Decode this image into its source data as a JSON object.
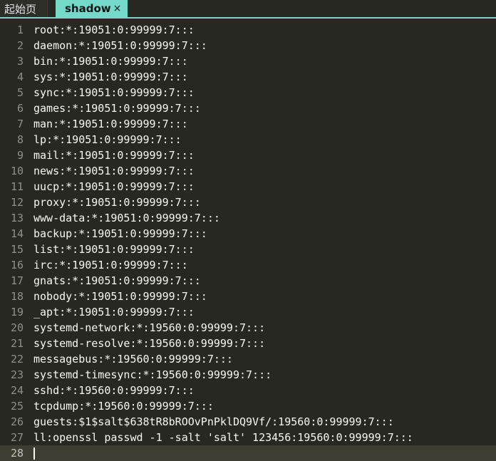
{
  "tabs": [
    {
      "label": "起始页",
      "active": false
    },
    {
      "label": "shadow",
      "active": true,
      "close_glyph": "×"
    }
  ],
  "editor": {
    "lines": [
      {
        "num": "1",
        "text": "root:*:19051:0:99999:7:::"
      },
      {
        "num": "2",
        "text": "daemon:*:19051:0:99999:7:::"
      },
      {
        "num": "3",
        "text": "bin:*:19051:0:99999:7:::"
      },
      {
        "num": "4",
        "text": "sys:*:19051:0:99999:7:::"
      },
      {
        "num": "5",
        "text": "sync:*:19051:0:99999:7:::"
      },
      {
        "num": "6",
        "text": "games:*:19051:0:99999:7:::"
      },
      {
        "num": "7",
        "text": "man:*:19051:0:99999:7:::"
      },
      {
        "num": "8",
        "text": "lp:*:19051:0:99999:7:::"
      },
      {
        "num": "9",
        "text": "mail:*:19051:0:99999:7:::"
      },
      {
        "num": "10",
        "text": "news:*:19051:0:99999:7:::"
      },
      {
        "num": "11",
        "text": "uucp:*:19051:0:99999:7:::"
      },
      {
        "num": "12",
        "text": "proxy:*:19051:0:99999:7:::"
      },
      {
        "num": "13",
        "text": "www-data:*:19051:0:99999:7:::"
      },
      {
        "num": "14",
        "text": "backup:*:19051:0:99999:7:::"
      },
      {
        "num": "15",
        "text": "list:*:19051:0:99999:7:::"
      },
      {
        "num": "16",
        "text": "irc:*:19051:0:99999:7:::"
      },
      {
        "num": "17",
        "text": "gnats:*:19051:0:99999:7:::"
      },
      {
        "num": "18",
        "text": "nobody:*:19051:0:99999:7:::"
      },
      {
        "num": "19",
        "text": "_apt:*:19051:0:99999:7:::"
      },
      {
        "num": "20",
        "text": "systemd-network:*:19560:0:99999:7:::"
      },
      {
        "num": "21",
        "text": "systemd-resolve:*:19560:0:99999:7:::"
      },
      {
        "num": "22",
        "text": "messagebus:*:19560:0:99999:7:::"
      },
      {
        "num": "23",
        "text": "systemd-timesync:*:19560:0:99999:7:::"
      },
      {
        "num": "24",
        "text": "sshd:*:19560:0:99999:7:::"
      },
      {
        "num": "25",
        "text": "tcpdump:*:19560:0:99999:7:::"
      },
      {
        "num": "26",
        "text": "guests:$1$salt$638tR8bROOvPnPklDQ9Vf/:19560:0:99999:7:::"
      },
      {
        "num": "27",
        "text": "ll:openssl passwd -1 -salt 'salt' 123456:19560:0:99999:7:::"
      },
      {
        "num": "28",
        "text": ""
      }
    ],
    "current_line": 28
  },
  "colors": {
    "background": "#272822",
    "tab_active": "#74d9c8",
    "text": "#f8f8f2",
    "line_number": "#8f908a",
    "current_line_highlight": "#3e3d32"
  }
}
